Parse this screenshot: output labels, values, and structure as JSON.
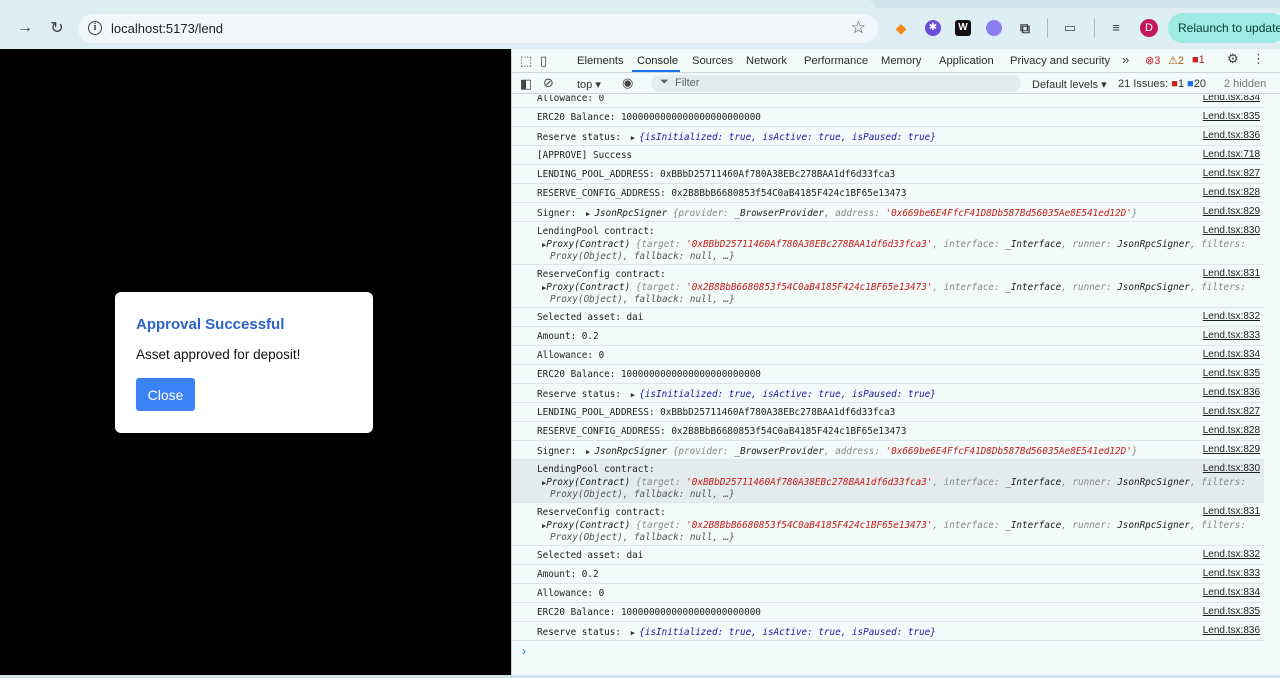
{
  "browser": {
    "url": "localhost:5173/lend",
    "relaunch_label": "Relaunch to update",
    "avatar_letter": "D",
    "extensions": [
      {
        "name": "metamask-icon",
        "glyph": "🦊",
        "color": "#f6851b"
      },
      {
        "name": "extension-purple-icon",
        "glyph": "✱",
        "color": "#6c4bd8"
      },
      {
        "name": "wordtune-icon",
        "glyph": "W.",
        "color": "#111111"
      },
      {
        "name": "extension-cloud-icon",
        "glyph": "☁",
        "color": "#8b7cf0"
      }
    ]
  },
  "modal": {
    "title": "Approval Successful",
    "message": "Asset approved for deposit!",
    "close_label": "Close"
  },
  "devtools": {
    "tabs": [
      "Elements",
      "Console",
      "Sources",
      "Network",
      "Performance",
      "Memory",
      "Application",
      "Privacy and security"
    ],
    "active_tab": "Console",
    "errors": "3",
    "warnings": "2",
    "info_count": "1",
    "context": "top",
    "filter_placeholder": "Filter",
    "levels": "Default levels",
    "issues_label": "21 Issues:",
    "issues_errors": "1",
    "issues_info": "20",
    "hidden": "2 hidden"
  },
  "console": {
    "rows": [
      {
        "text": "Allowance: 0",
        "src": "Lend.tsx:834"
      },
      {
        "text": "ERC20 Balance: 1000000000000000000000000",
        "src": "Lend.tsx:835"
      },
      {
        "kind": "reserve",
        "label": "Reserve status: ",
        "src": "Lend.tsx:836"
      },
      {
        "text": "[APPROVE] Success",
        "src": "Lend.tsx:718"
      },
      {
        "text": "LENDING_POOL_ADDRESS: 0xBBbD25711460Af780A38EBc278BAA1df6d33fca3",
        "src": "Lend.tsx:827"
      },
      {
        "text": "RESERVE_CONFIG_ADDRESS: 0x2B8BbB6680853f54C0aB4185F424c1BF65e13473",
        "src": "Lend.tsx:828"
      },
      {
        "kind": "signer",
        "label": "Signer: ",
        "src": "Lend.tsx:829"
      },
      {
        "kind": "contract",
        "label": "LendingPool contract:",
        "target": "'0xBBbD25711460Af780A38EBc278BAA1df6d33fca3'",
        "src": "Lend.tsx:830"
      },
      {
        "kind": "contract",
        "label": "ReserveConfig contract:",
        "target": "'0x2B8BbB6680853f54C0aB4185F424c1BF65e13473'",
        "src": "Lend.tsx:831"
      },
      {
        "text": "Selected asset: dai",
        "src": "Lend.tsx:832"
      },
      {
        "text": "Amount: 0.2",
        "src": "Lend.tsx:833"
      },
      {
        "text": "Allowance: 0",
        "src": "Lend.tsx:834"
      },
      {
        "text": "ERC20 Balance: 1000000000000000000000000",
        "src": "Lend.tsx:835"
      },
      {
        "kind": "reserve",
        "label": "Reserve status: ",
        "src": "Lend.tsx:836"
      },
      {
        "text": "LENDING_POOL_ADDRESS: 0xBBbD25711460Af780A38EBc278BAA1df6d33fca3",
        "src": "Lend.tsx:827"
      },
      {
        "text": "RESERVE_CONFIG_ADDRESS: 0x2B8BbB6680853f54C0aB4185F424c1BF65e13473",
        "src": "Lend.tsx:828"
      },
      {
        "kind": "signer",
        "label": "Signer: ",
        "src": "Lend.tsx:829"
      },
      {
        "kind": "contract",
        "label": "LendingPool contract:",
        "target": "'0xBBbD25711460Af780A38EBc278BAA1df6d33fca3'",
        "src": "Lend.tsx:830",
        "highlight": true
      },
      {
        "kind": "contract",
        "label": "ReserveConfig contract:",
        "target": "'0x2B8BbB6680853f54C0aB4185F424c1BF65e13473'",
        "src": "Lend.tsx:831"
      },
      {
        "text": "Selected asset: dai",
        "src": "Lend.tsx:832"
      },
      {
        "text": "Amount: 0.2",
        "src": "Lend.tsx:833"
      },
      {
        "text": "Allowance: 0",
        "src": "Lend.tsx:834"
      },
      {
        "text": "ERC20 Balance: 1000000000000000000000000",
        "src": "Lend.tsx:835"
      },
      {
        "kind": "reserve",
        "label": "Reserve status: ",
        "src": "Lend.tsx:836"
      }
    ],
    "reserve_object": "{isInitialized: true, isActive: true, isPaused: true}",
    "signer_class": "JsonRpcSigner",
    "signer_provider": "_BrowserProvider",
    "signer_address": "'0x669be6E4FfcF41D8Db587Bd56035Ae8E541ed12D'",
    "contract_prefix": "Proxy(Contract)",
    "contract_interface": "_Interface",
    "contract_runner": "JsonRpcSigner",
    "contract_line3": "Proxy(Object), fallback: null, …}"
  }
}
